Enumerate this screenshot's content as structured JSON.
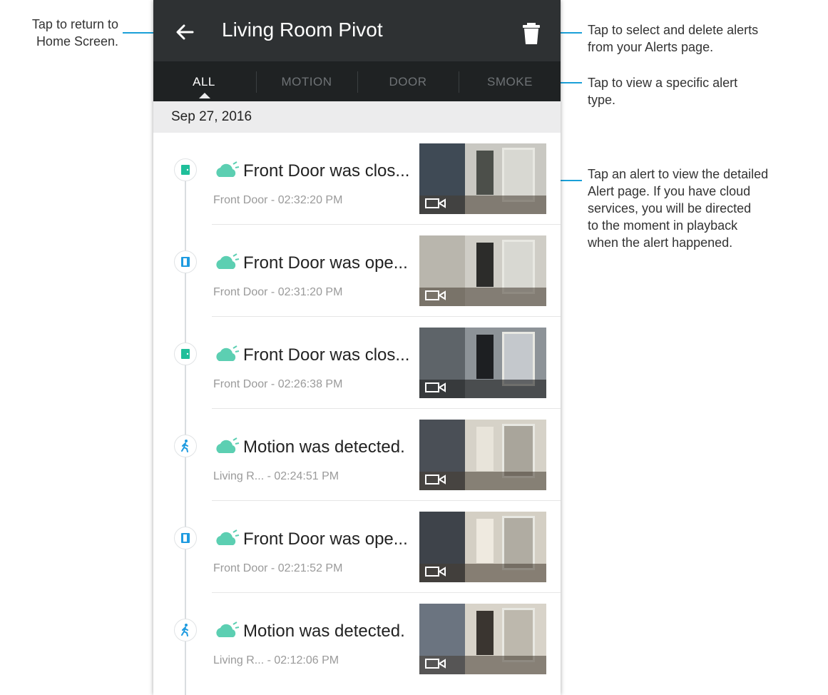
{
  "callouts": {
    "back": "Tap to return to\nHome Screen.",
    "delete": "Tap to select and delete alerts\nfrom your Alerts page.",
    "filter": "Tap to view a specific alert\ntype.",
    "alert": "Tap an alert to view the detailed\nAlert page. If you have cloud\nservices, you will be directed\nto the moment in playback\nwhen the alert happened."
  },
  "header": {
    "title": "Living Room Pivot",
    "back_icon": "arrow-left-icon",
    "delete_icon": "trash-icon"
  },
  "tabs": [
    {
      "label": "ALL",
      "active": true
    },
    {
      "label": "MOTION",
      "active": false
    },
    {
      "label": "DOOR",
      "active": false
    },
    {
      "label": "SMOKE",
      "active": false
    }
  ],
  "date_header": "Sep 27, 2016",
  "alerts": [
    {
      "type": "door-closed-icon",
      "title": "Front Door was clos...",
      "subtitle": "Front Door - 02:32:20 PM"
    },
    {
      "type": "door-opened-icon",
      "title": "Front Door was ope...",
      "subtitle": "Front Door - 02:31:20 PM"
    },
    {
      "type": "door-closed-icon",
      "title": "Front Door was clos...",
      "subtitle": "Front Door - 02:26:38 PM"
    },
    {
      "type": "motion-icon",
      "title": "Motion was detected.",
      "subtitle": "Living R... - 02:24:51 PM"
    },
    {
      "type": "door-opened-icon",
      "title": "Front Door was ope...",
      "subtitle": "Front Door - 02:21:52 PM"
    },
    {
      "type": "motion-icon",
      "title": "Motion was detected.",
      "subtitle": "Living R... - 02:12:06 PM"
    }
  ],
  "colors": {
    "appbar": "#2e3133",
    "tabbar": "#1f2223",
    "accent": "#1aa0d8",
    "door_closed": "#1fbf9a",
    "door_opened": "#1e9be0",
    "cloud": "#5ccfb2"
  }
}
